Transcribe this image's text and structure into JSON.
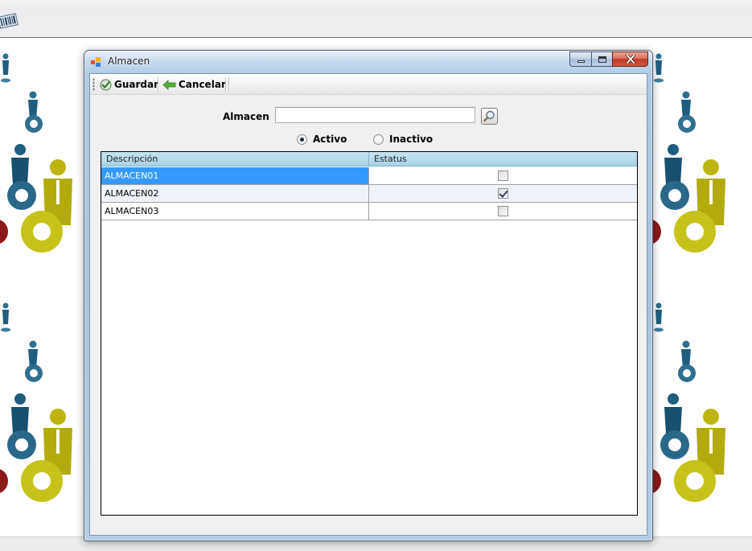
{
  "window": {
    "title": "Almacen"
  },
  "toolbar": {
    "save_label": "Guardar",
    "cancel_label": "Cancelar"
  },
  "filter": {
    "almacen_label": "Almacen",
    "almacen_value": "",
    "radio_options": [
      {
        "label": "Activo",
        "checked": true
      },
      {
        "label": "Inactivo",
        "checked": false
      }
    ]
  },
  "grid": {
    "columns": [
      "Descripción",
      "Estatus"
    ],
    "rows": [
      {
        "descripcion": "ALMACEN01",
        "estatus": false,
        "selected": true
      },
      {
        "descripcion": "ALMACEN02",
        "estatus": true,
        "selected": false
      },
      {
        "descripcion": "ALMACEN03",
        "estatus": false,
        "selected": false
      }
    ]
  },
  "colors": {
    "selection": "#3399ff",
    "grid_header": "#b7dcec",
    "window_frame": "#a7c4e0",
    "close_button": "#c1392b"
  },
  "icons": {
    "parent_toolbar": "barcode-icon",
    "window": "app-icon",
    "save": "check-icon",
    "cancel": "green-arrow-left-icon",
    "search": "magnifier-icon"
  }
}
